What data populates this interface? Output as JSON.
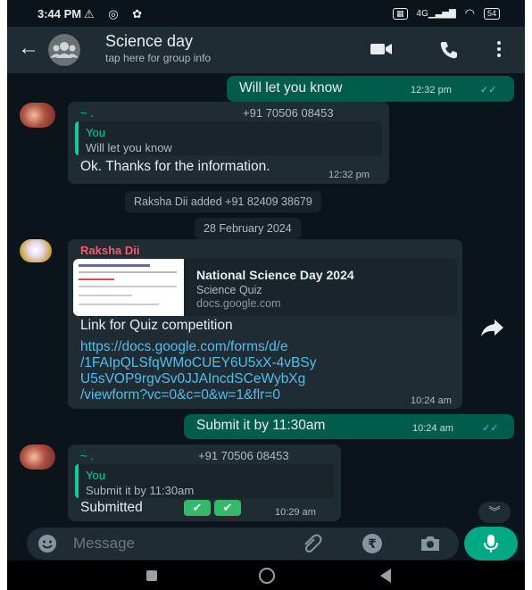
{
  "status_bar": {
    "time": "3:44 PM",
    "signal_label": "4G",
    "battery": "54"
  },
  "header": {
    "title": "Science day",
    "subtitle": "tap here for group info"
  },
  "messages": {
    "m1": {
      "text": "Will let you know",
      "time": "12:32 pm"
    },
    "m2": {
      "sender": "~ .",
      "phone": "+91 70506 08453",
      "quote_name": "You",
      "quote_text": "Will let you know",
      "text": "Ok. Thanks for the information.",
      "time": "12:32 pm"
    },
    "sys1": "Raksha Dii added +91 82409 38679",
    "date1": "28 February 2024",
    "m3": {
      "sender": "Raksha Dii",
      "preview_title": "National Science Day 2024",
      "preview_sub": "Science Quiz",
      "preview_domain": "docs.google.com",
      "caption": "Link for Quiz competition",
      "link_lines": [
        "https://docs.google.com/forms/d/e",
        "/1FAIpQLSfqWMoCUEY6U5xX-4vBSy",
        "U5sVOP9rgvSv0JJAIncdSCeWybXg",
        "/viewform?vc=0&c=0&w=1&flr=0"
      ],
      "time": "10:24 am"
    },
    "m4": {
      "text": "Submit it by 11:30am",
      "time": "10:24 am"
    },
    "m5": {
      "sender": "~ .",
      "phone": "+91 70506 08453",
      "quote_name": "You",
      "quote_text": "Submit it by 11:30am",
      "text": "Submitted",
      "time": "10:29 am"
    }
  },
  "composer": {
    "placeholder": "Message"
  },
  "colors": {
    "background": "#0b141a",
    "outgoing": "#005c4b",
    "incoming": "#202c33",
    "accent": "#00a884",
    "header": "#1f2c34"
  },
  "icons": [
    "back-arrow-icon",
    "group-icon",
    "video-call-icon",
    "phone-icon",
    "more-icon",
    "forward-icon",
    "scroll-down-icon",
    "emoji-icon",
    "attach-icon",
    "rupee-icon",
    "camera-icon",
    "mic-icon"
  ]
}
